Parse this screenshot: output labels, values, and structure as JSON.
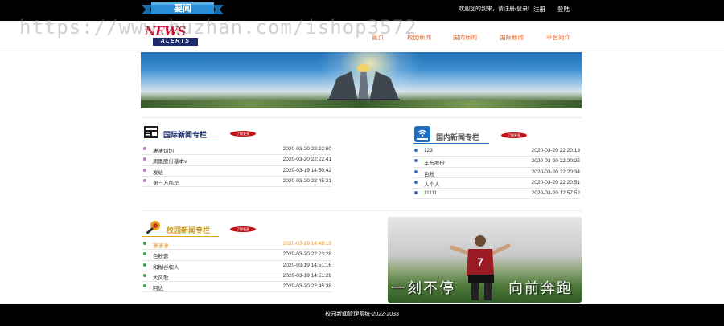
{
  "topbar": {
    "ribbon_text": "要闻",
    "welcome_text": "欢迎您的到来，请注册/登录!",
    "register_label": "注册",
    "login_label": "登陆"
  },
  "header": {
    "logo_news": "NEWS",
    "logo_alerts": "ALERTS",
    "nav": [
      {
        "label": "首页"
      },
      {
        "label": "校园新闻"
      },
      {
        "label": "国内新闻"
      },
      {
        "label": "国际新闻"
      },
      {
        "label": "平台简介"
      }
    ]
  },
  "international": {
    "title": "国际新闻专栏",
    "more_label": "了解更多",
    "items": [
      {
        "title": "凄凄切切",
        "date": "2020-03-20 22:22:00"
      },
      {
        "title": "凤凰股份基本v",
        "date": "2020-03-20 22:22:41"
      },
      {
        "title": "发给",
        "date": "2020-03-19 14:50:42"
      },
      {
        "title": "第三方那是",
        "date": "2020-03-20 22:45:21"
      }
    ]
  },
  "domestic": {
    "title": "国内新闻专栏",
    "more_label": "了解更多",
    "items": [
      {
        "title": "123",
        "date": "2020-03-20 22:20:13"
      },
      {
        "title": "丰东股份",
        "date": "2020-03-20 22:20:25"
      },
      {
        "title": "色粉",
        "date": "2020-03-20 22:20:34"
      },
      {
        "title": "人个人",
        "date": "2020-03-20 22:20:51"
      },
      {
        "title": "11111",
        "date": "2020-03-20 12:57:52"
      }
    ]
  },
  "campus": {
    "title": "校园新闻专栏",
    "more_label": "了解更多",
    "items": [
      {
        "title": "凄凄凄",
        "date": "2020-03-19 14:48:19"
      },
      {
        "title": "色粉蓉",
        "date": "2020-03-20 22:23:28"
      },
      {
        "title": "和糊谷和人",
        "date": "2020-03-19 14:51:16"
      },
      {
        "title": "大风歌",
        "date": "2020-03-19 14:51:29"
      },
      {
        "title": "阿达",
        "date": "2020-03-20 22:45:38"
      }
    ]
  },
  "player_image": {
    "caption_left": "一刻不停",
    "caption_right": "向前奔跑",
    "jersey_number": "7"
  },
  "footer": {
    "text": "校园新闻管理系统-2022-2033"
  },
  "watermark": "https://www.huzhan.com/ishop3572",
  "colors": {
    "accent_orange": "#e0662c",
    "highlight": "#e89b2e",
    "navy": "#1b2a6b",
    "badge_red": "#c0141a"
  }
}
